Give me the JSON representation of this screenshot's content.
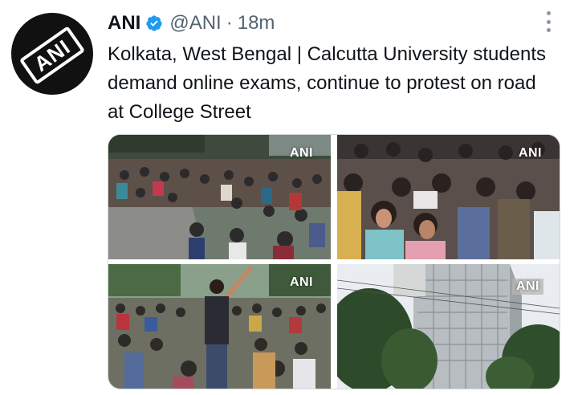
{
  "author": {
    "name": "ANI",
    "handle": "@ANI",
    "separator": "·",
    "time": "18m",
    "avatar_logo": "ANI",
    "verified_color": "#1d9bf0"
  },
  "tweet": {
    "text": "Kolkata, West Bengal | Calcutta University students demand online exams, continue to protest on road at College Street"
  },
  "media": {
    "watermark": "ANI",
    "photos": [
      {
        "name": "photo-crowd-sitting-road",
        "watermark": "ANI"
      },
      {
        "name": "photo-students-closeup",
        "watermark": "ANI"
      },
      {
        "name": "photo-protester-raising-arm",
        "watermark": "ANI"
      },
      {
        "name": "photo-university-building",
        "watermark": "ANI"
      }
    ]
  },
  "icons": {
    "verified": "verified-badge-icon",
    "more": "more-options-icon"
  }
}
